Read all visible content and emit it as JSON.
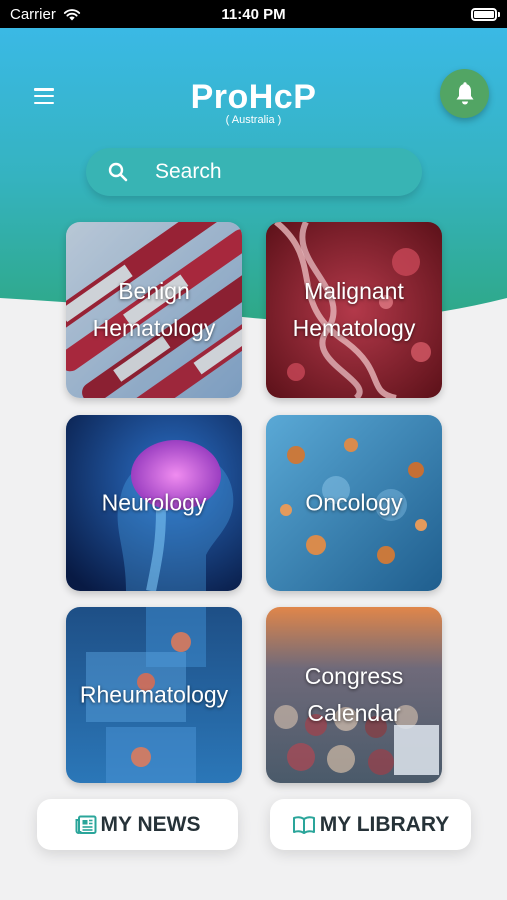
{
  "status_bar": {
    "carrier": "Carrier",
    "time": "11:40 PM"
  },
  "header": {
    "title": "ProHcP",
    "subtitle": "( Australia )"
  },
  "search": {
    "placeholder": "Search"
  },
  "categories": [
    {
      "label": "Benign\nHematology"
    },
    {
      "label": "Malignant\nHematology"
    },
    {
      "label": "Neurology"
    },
    {
      "label": "Oncology"
    },
    {
      "label": "Rheumatology"
    },
    {
      "label": "Congress\nCalendar"
    }
  ],
  "bottom_bar": {
    "news_label": "MY NEWS",
    "library_label": "MY LIBRARY"
  },
  "colors": {
    "gradient_top": "#3ab9ea",
    "gradient_bottom": "#2fa88a",
    "search_bg": "#38b4b4",
    "bell_bg": "#52a564",
    "icon_teal": "#2aa59a",
    "background": "#f1f1f2"
  },
  "icons": {
    "menu": "hamburger-icon",
    "notifications": "bell-icon",
    "search": "search-icon",
    "news": "newspaper-icon",
    "library": "book-icon",
    "wifi": "wifi-icon",
    "battery": "battery-icon"
  }
}
